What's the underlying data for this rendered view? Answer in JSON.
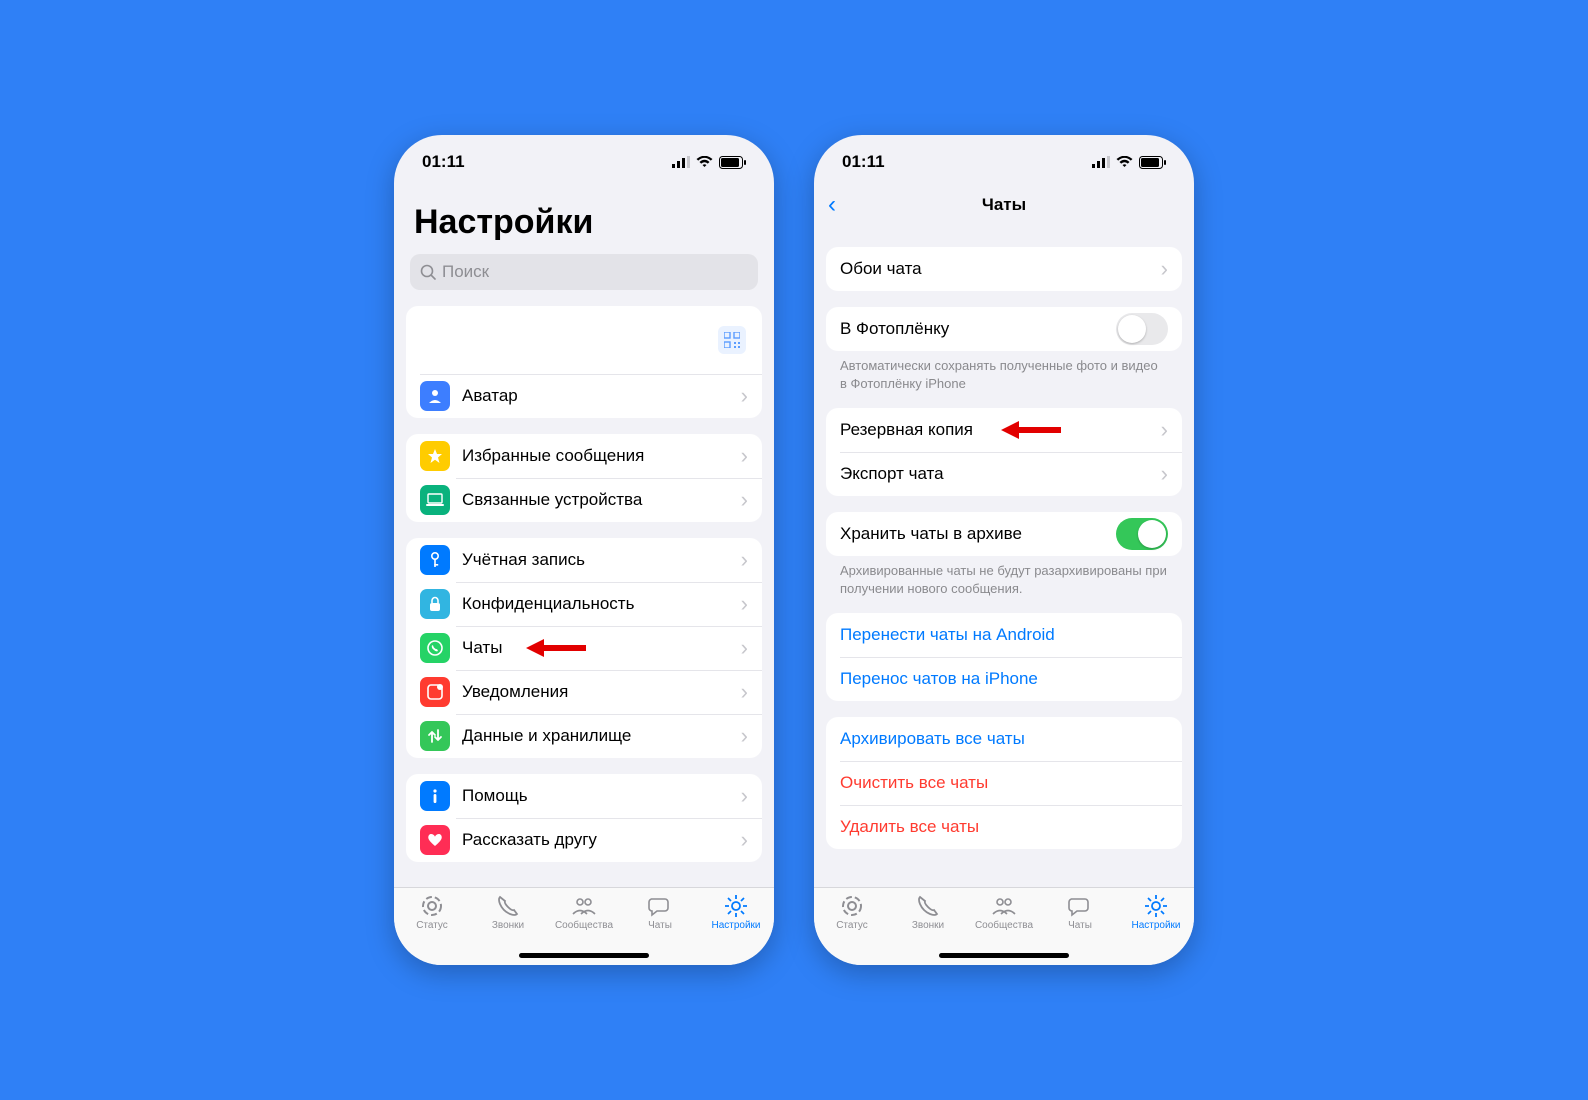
{
  "status": {
    "time": "01:11"
  },
  "phone1": {
    "title": "Настройки",
    "search_placeholder": "Поиск",
    "rows": {
      "avatar": "Аватар",
      "starred": "Избранные сообщения",
      "linked": "Связанные устройства",
      "account": "Учётная запись",
      "privacy": "Конфиденциальность",
      "chats": "Чаты",
      "notifications": "Уведомления",
      "storage": "Данные и хранилище",
      "help": "Помощь",
      "tell": "Рассказать другу"
    }
  },
  "phone2": {
    "nav_title": "Чаты",
    "rows": {
      "wallpaper": "Обои чата",
      "camera_roll": "В Фотоплёнку",
      "camera_roll_note": "Автоматически сохранять полученные фото и видео в Фотоплёнку iPhone",
      "backup": "Резервная копия",
      "export": "Экспорт чата",
      "keep_archived": "Хранить чаты в архиве",
      "keep_note": "Архивированные чаты не будут разархивированы при получении нового сообщения.",
      "move_android": "Перенести чаты на Android",
      "move_iphone": "Перенос чатов на iPhone",
      "archive_all": "Архивировать все чаты",
      "clear_all": "Очистить все чаты",
      "delete_all": "Удалить все чаты"
    }
  },
  "tabs": {
    "status": "Статус",
    "calls": "Звонки",
    "communities": "Сообщества",
    "chats": "Чаты",
    "settings": "Настройки"
  }
}
